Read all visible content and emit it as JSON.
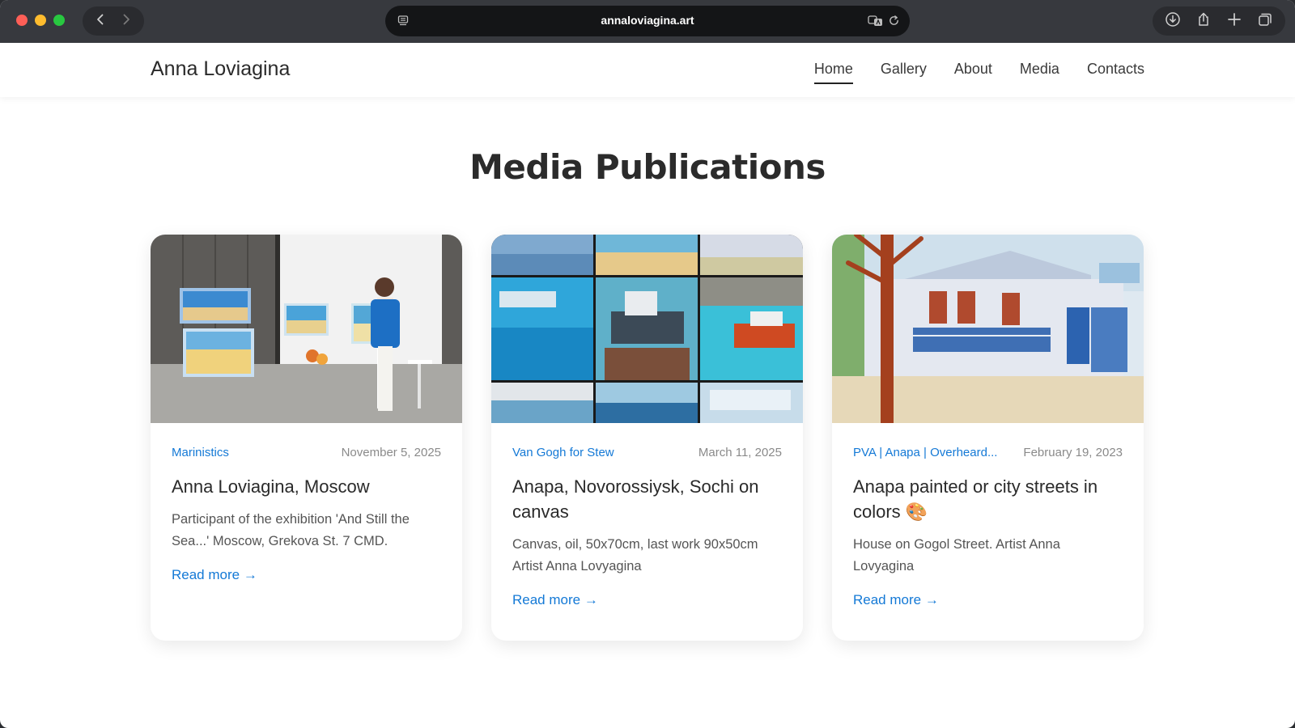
{
  "browser": {
    "url": "annaloviagina.art"
  },
  "site": {
    "title": "Anna Loviagina",
    "nav": [
      {
        "label": "Home",
        "active": true
      },
      {
        "label": "Gallery",
        "active": false
      },
      {
        "label": "About",
        "active": false
      },
      {
        "label": "Media",
        "active": false
      },
      {
        "label": "Contacts",
        "active": false
      }
    ]
  },
  "main": {
    "heading": "Media Publications",
    "cards": [
      {
        "category": "Marinistics",
        "date": "November 5, 2025",
        "title": "Anna Loviagina, Moscow",
        "description": "Participant of the exhibition 'And Still the Sea...' Moscow, Grekova St. 7 CMD.",
        "read_more": "Read more →"
      },
      {
        "category": "Van Gogh for Stew",
        "date": "March 11, 2025",
        "title": "Anapa, Novorossiysk, Sochi on canvas",
        "description": "Canvas, oil, 50x70cm, last work 90x50cm Artist Anna Lovyagina",
        "read_more": "Read more →"
      },
      {
        "category": "PVA | Anapa | Overheard...",
        "date": "February 19, 2023",
        "title": "Anapa painted or city streets in colors 🎨",
        "description": "House on Gogol Street. Artist Anna Lovyagina",
        "read_more": "Read more →"
      }
    ]
  },
  "colors": {
    "accent": "#1479d6",
    "chrome": "#37393e",
    "urlbar": "#141517"
  }
}
